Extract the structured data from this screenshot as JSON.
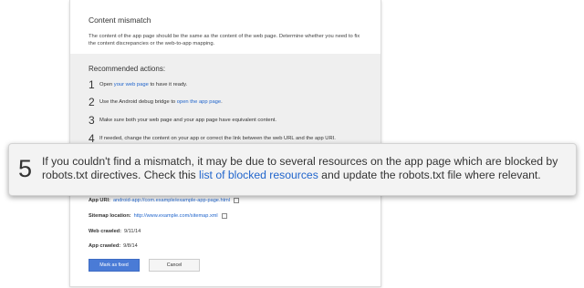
{
  "card": {
    "title": "Content mismatch",
    "description": "The content of the app page should be the same as the content of the web page. Determine whether you need to fix the content discrepancies or the web-to-app mapping."
  },
  "recommended": {
    "heading": "Recommended actions:",
    "steps": [
      {
        "num": "1",
        "pre": "Open ",
        "link": "your web page",
        "post": " to have it ready."
      },
      {
        "num": "2",
        "pre": "Use the Android debug bridge to ",
        "link": "open the app page",
        "post": "."
      },
      {
        "num": "3",
        "pre": "Make sure both your web page and your app page have equivalent content.",
        "link": "",
        "post": ""
      },
      {
        "num": "4",
        "pre": "If needed, change the content on your app or correct the link between the web URL and the app URI.",
        "link": "",
        "post": ""
      }
    ]
  },
  "callout": {
    "num": "5",
    "pre": "If you couldn't find a mismatch, it may be due to several resources on the app page which are blocked by robots.txt directives. Check this ",
    "link": "list of blocked resources",
    "post": " and update the robots.txt file where relevant."
  },
  "details": {
    "app_uri_label": "App URI:",
    "app_uri_value": "android-app://com.example/example-app-page.html",
    "sitemap_label": "Sitemap location:",
    "sitemap_value": "http://www.example.com/sitemap.xml",
    "web_crawled_label": "Web crawled:",
    "web_crawled_value": "9/11/14",
    "app_crawled_label": "App crawled:",
    "app_crawled_value": "9/8/14"
  },
  "buttons": {
    "mark_fixed": "Mark as fixed",
    "cancel": "Cancel"
  },
  "colors": {
    "link": "#2266cc",
    "primary_button": "#4a7bd6",
    "recommend_bg": "#efefef"
  }
}
